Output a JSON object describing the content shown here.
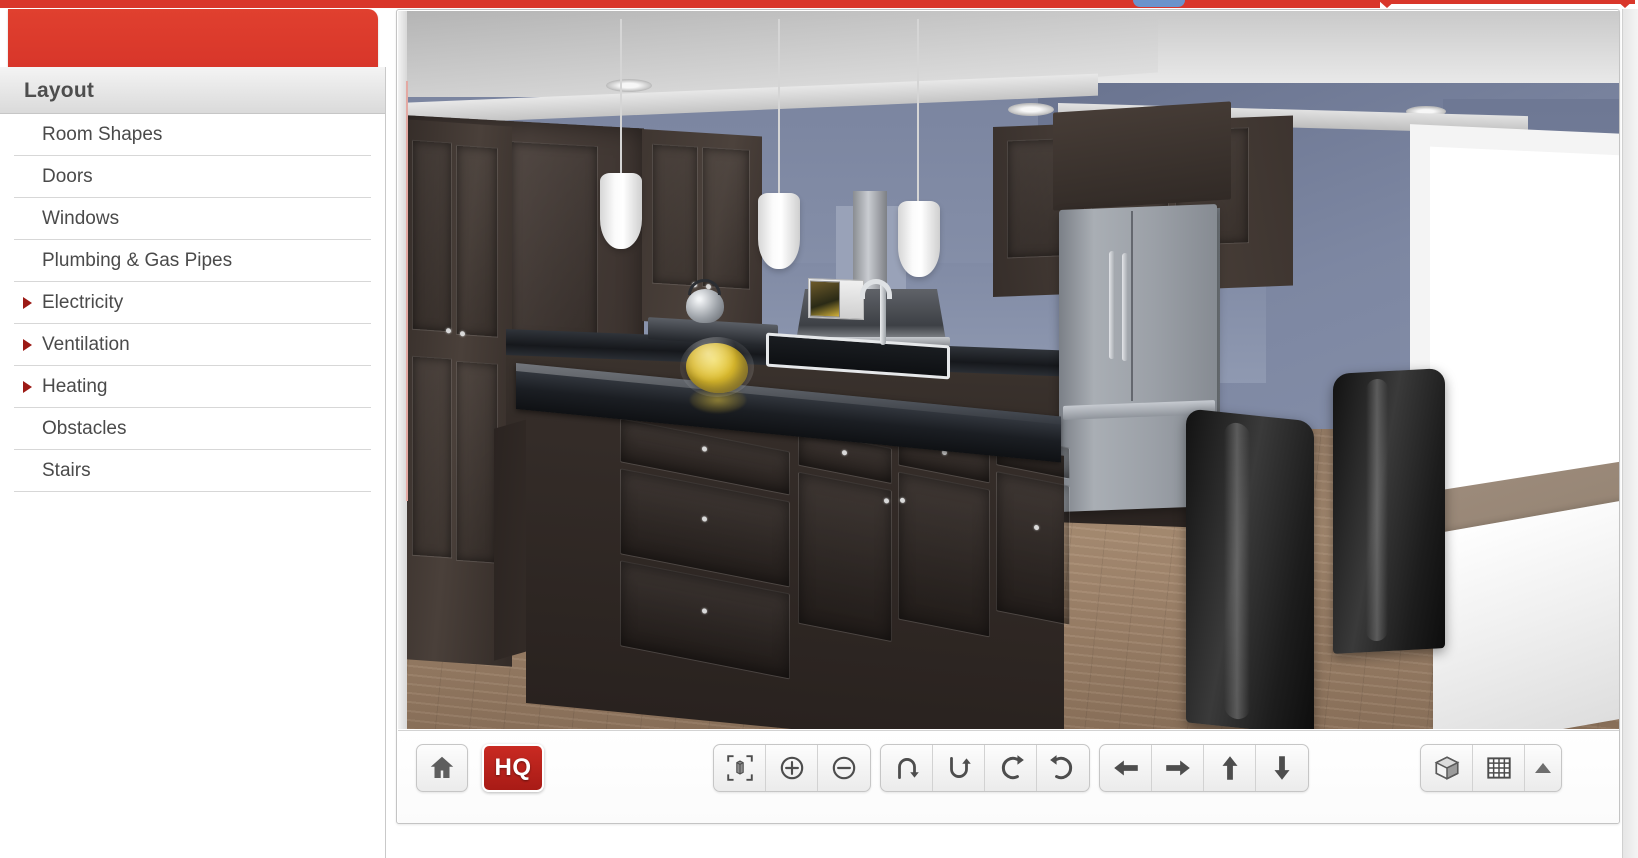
{
  "app": {
    "accent_red": "#d9362a",
    "panel_bg": "#ffffff",
    "text_color": "#4a4a4a"
  },
  "sidebar": {
    "tab_label": "",
    "title": "Layout",
    "items": [
      {
        "label": "Room Shapes",
        "expandable": false
      },
      {
        "label": "Doors",
        "expandable": false
      },
      {
        "label": "Windows",
        "expandable": false
      },
      {
        "label": "Plumbing & Gas Pipes",
        "expandable": false
      },
      {
        "label": "Electricity",
        "expandable": true
      },
      {
        "label": "Ventilation",
        "expandable": true
      },
      {
        "label": "Heating",
        "expandable": true
      },
      {
        "label": "Obstacles",
        "expandable": false
      },
      {
        "label": "Stairs",
        "expandable": false
      }
    ]
  },
  "viewport": {
    "scene_description": "3D rendered kitchen interior with dark espresso shaker cabinets, black granite countertops, center island, stainless French-door refrigerator, stainless range hood, three white pendant lights, blue-grey walls, wood plank floor, and two black dining chairs beside a white table near an open doorway.",
    "scene": {
      "wall_color": "#8d97af",
      "cabinet_color": "#3a312d",
      "counter_color": "#1b1e23",
      "floor_color": "#a98d73",
      "appliance_color": "#9ba0a7"
    }
  },
  "toolbar": {
    "home_label": "home-view",
    "hq_label": "HQ",
    "zoom_group": [
      {
        "name": "fit-to-object",
        "label": "Fit object to view"
      },
      {
        "name": "zoom-in",
        "label": "Zoom in"
      },
      {
        "name": "zoom-out",
        "label": "Zoom out"
      }
    ],
    "rotate_group": [
      {
        "name": "tilt-up",
        "label": "Tilt up"
      },
      {
        "name": "tilt-down",
        "label": "Tilt down"
      },
      {
        "name": "rotate-left",
        "label": "Rotate left"
      },
      {
        "name": "rotate-right",
        "label": "Rotate right"
      }
    ],
    "pan_group": [
      {
        "name": "pan-left",
        "label": "Move left"
      },
      {
        "name": "pan-right",
        "label": "Move right"
      },
      {
        "name": "pan-up",
        "label": "Move up"
      },
      {
        "name": "pan-down",
        "label": "Move down"
      }
    ],
    "view_group": [
      {
        "name": "view-3d",
        "label": "3D view"
      },
      {
        "name": "view-2d",
        "label": "2D grid view"
      },
      {
        "name": "expand",
        "label": "Expand options"
      }
    ]
  }
}
